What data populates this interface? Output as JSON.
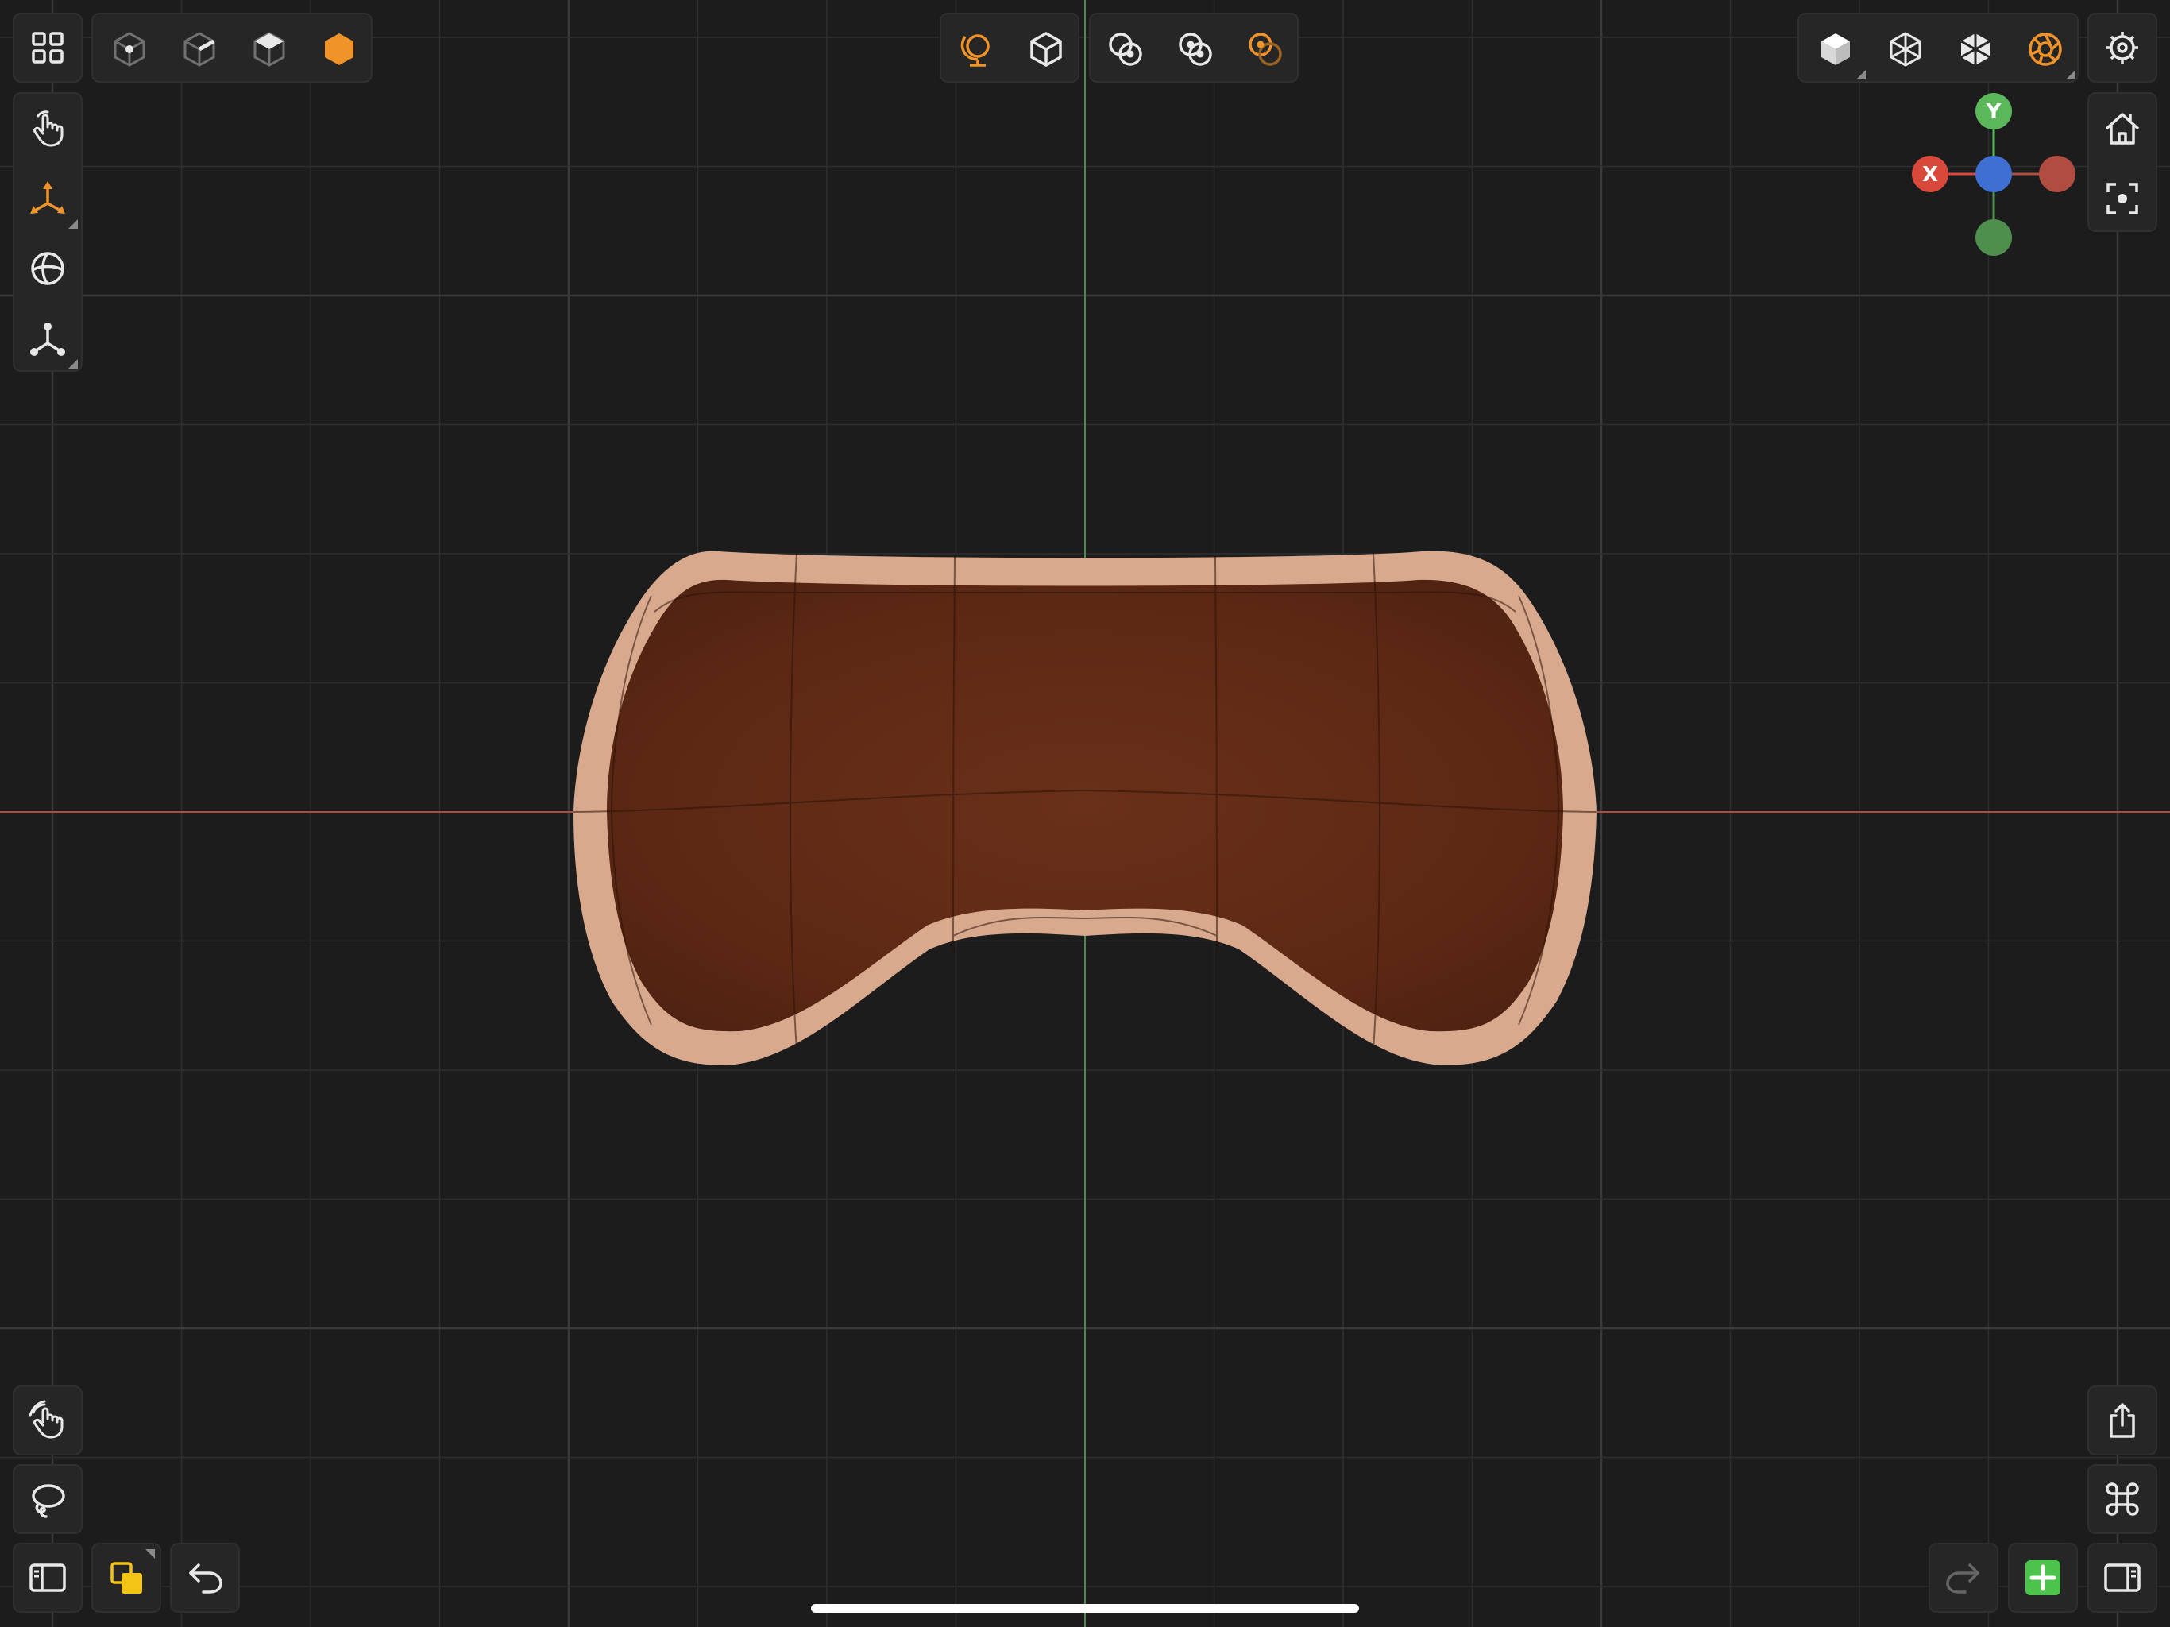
{
  "viewport": {
    "background": "#1c1c1d",
    "grid_color": "#2e2e30",
    "x_axis_color": "#b04a3c",
    "y_axis_color": "#4a8a4a",
    "mesh_color": "#5e2a16",
    "mesh_rim_color": "#e8c9b6"
  },
  "gizmo": {
    "x_label": "X",
    "y_label": "Y",
    "x_color": "#d9493b",
    "y_color": "#5bb85a",
    "z_color": "#3e6fd1",
    "neg_x_color": "#b04d40",
    "neg_y_color": "#4f8f4d"
  },
  "accent_color": "#f0942a",
  "add_button_color": "#4cc34a",
  "layer_icon_color": "#f3c316",
  "toolbar": {
    "top_left": [
      "grid-menu-icon",
      "vertex-select-icon",
      "edge-select-icon",
      "face-select-icon",
      "object-select-icon"
    ],
    "top_center": [
      "global-space-icon",
      "local-space-icon",
      "pivot-individual-icon",
      "pivot-median-icon",
      "pivot-active-icon"
    ],
    "top_right": [
      "solid-shading-icon",
      "wireframe-shading-icon",
      "xray-shading-icon",
      "rendered-shading-icon",
      "settings-icon"
    ],
    "left_tools": [
      "pan-hand-icon",
      "move-gizmo-icon",
      "rotate-view-icon",
      "pivot-tool-icon"
    ],
    "right_view": [
      "home-view-icon",
      "frame-selection-icon"
    ],
    "bottom_left": [
      "touch-mode-icon",
      "lasso-icon",
      "sidebar-left-icon",
      "layers-icon",
      "undo-icon"
    ],
    "bottom_right": [
      "share-icon",
      "command-icon",
      "redo-icon",
      "add-object-icon",
      "sidebar-right-icon"
    ]
  }
}
